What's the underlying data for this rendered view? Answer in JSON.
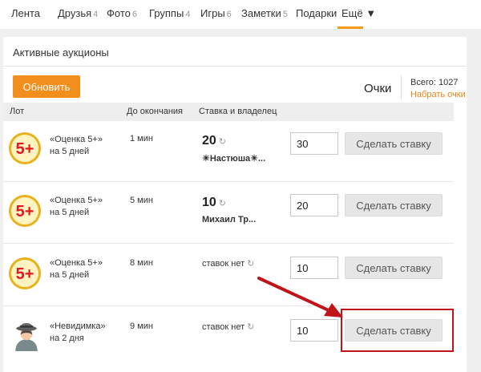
{
  "nav": {
    "items": [
      {
        "label": "Лента",
        "count": ""
      },
      {
        "label": "Друзья",
        "count": "4"
      },
      {
        "label": "Фото",
        "count": "6"
      },
      {
        "label": "Группы",
        "count": "4"
      },
      {
        "label": "Игры",
        "count": "6"
      },
      {
        "label": "Заметки",
        "count": "5"
      },
      {
        "label": "Подарки",
        "count": ""
      },
      {
        "label": "Ещё ▼",
        "count": ""
      }
    ]
  },
  "panel": {
    "title": "Активные аукционы",
    "refresh_label": "Обновить",
    "points_label": "Очки",
    "total_points": "Всего: 1027",
    "earn_points_label": "Набрать очки"
  },
  "table": {
    "headers": [
      "Лот",
      "До окончания",
      "Ставка и владелец"
    ],
    "rows": [
      {
        "lot": "«Оценка 5+»",
        "duration": "на 5 дней",
        "time_left": "1 мин",
        "bid": "20",
        "owner": "☀Настюша☀...",
        "no_bid": "",
        "input_value": "30",
        "button": "Сделать ставку",
        "icon": "grade-5plus-icon"
      },
      {
        "lot": "«Оценка 5+»",
        "duration": "на 5 дней",
        "time_left": "5 мин",
        "bid": "10",
        "owner": "Михаил Тр...",
        "no_bid": "",
        "input_value": "20",
        "button": "Сделать ставку",
        "icon": "grade-5plus-icon"
      },
      {
        "lot": "«Оценка 5+»",
        "duration": "на 5 дней",
        "time_left": "8 мин",
        "bid": "",
        "owner": "",
        "no_bid": "ставок нет",
        "input_value": "10",
        "button": "Сделать ставку",
        "icon": "grade-5plus-icon"
      },
      {
        "lot": "«Невидимка»",
        "duration": "на 2 дня",
        "time_left": "9 мин",
        "bid": "",
        "owner": "",
        "no_bid": "ставок нет",
        "input_value": "10",
        "button": "Сделать ставку",
        "icon": "invisible-man-icon"
      }
    ]
  },
  "icons": {
    "refresh": "refresh-icon",
    "arrow": "red-arrow-annotation",
    "highlight": "red-highlight-box"
  },
  "colors": {
    "accent_orange": "#f28e1c",
    "link_orange": "#e88415",
    "annotation_red": "#c0141a"
  }
}
